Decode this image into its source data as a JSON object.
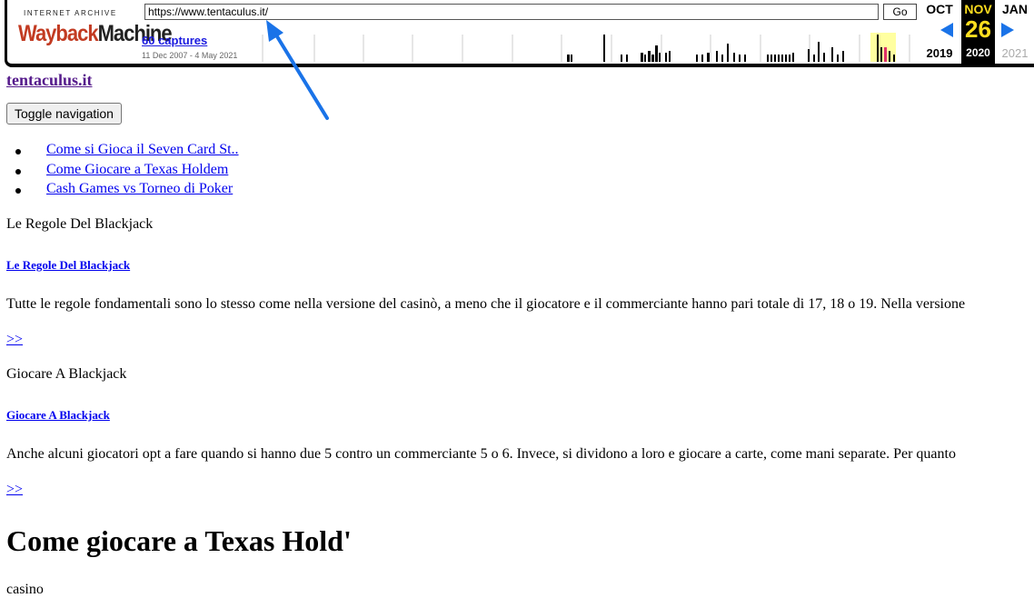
{
  "wayback": {
    "logo_top": "INTERNET ARCHIVE",
    "logo_main_a": "Wayback",
    "logo_main_b": "Machine",
    "url_value": "https://www.tentaculus.it/",
    "go_label": "Go",
    "captures_label": "60 captures",
    "date_range": "11 Dec 2007 - 4 May 2021",
    "calendar": {
      "prev_month": "OCT",
      "prev_year": "2019",
      "cur_month": "NOV",
      "cur_day": "26",
      "cur_year": "2020",
      "next_month": "JAN",
      "next_year": "2021"
    },
    "colors": {
      "accent": "#1a73e8",
      "highlight": "#ffde1f",
      "logo_red": "#c23b22"
    }
  },
  "page": {
    "site_title": "tentaculus.it",
    "toggle_label": "Toggle navigation",
    "nav_items": [
      "Come si Gioca il Seven Card St..",
      "Come Giocare a Texas Holdem",
      "Cash Games vs Torneo di Poker"
    ],
    "section1": {
      "title": "Le Regole Del Blackjack",
      "link": "Le Regole Del Blackjack",
      "body": "Tutte le regole fondamentali sono lo stesso come nella versione del casinò, a meno che il giocatore e il commerciante hanno pari totale di 17, 18 o 19. Nella versione",
      "more": ">>"
    },
    "section2": {
      "title": "Giocare A Blackjack",
      "link": "Giocare A Blackjack",
      "body": "Anche alcuni giocatori opt a fare quando si hanno due 5 contro un commerciante 5 o 6. Invece, si dividono a loro e giocare a carte, come mani separate. Per quanto",
      "more": ">>"
    },
    "heading": "Come giocare a Texas Hold'",
    "footer_word": "casino"
  }
}
